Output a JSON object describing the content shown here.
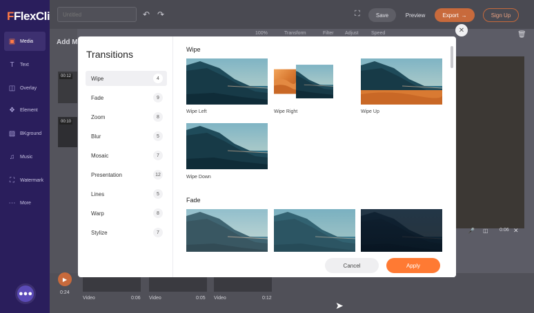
{
  "app": {
    "logo_text": "FlexClip",
    "project_title_placeholder": "Untitled",
    "accent_color": "#ff7a33",
    "sidebar_color": "#2a1e5c"
  },
  "sidebar": {
    "items": [
      {
        "label": "Media",
        "icon": "media-icon"
      },
      {
        "label": "Text",
        "icon": "text-icon"
      },
      {
        "label": "Overlay",
        "icon": "overlay-icon"
      },
      {
        "label": "Element",
        "icon": "element-icon"
      },
      {
        "label": "BKground",
        "icon": "background-icon"
      },
      {
        "label": "Music",
        "icon": "music-icon"
      },
      {
        "label": "Watermark",
        "icon": "watermark-icon"
      },
      {
        "label": "More",
        "icon": "more-icon"
      }
    ]
  },
  "toolbar": {
    "save_label": "Save",
    "preview_label": "Preview",
    "export_label": "Export",
    "signup_label": "Sign Up"
  },
  "background": {
    "media_title": "Add M",
    "thumb_a_time": "00:12",
    "thumb_b_time": "00:10",
    "zoom": "100%",
    "edit_tools": [
      "Transform",
      "Filter",
      "Adjust",
      "Speed"
    ],
    "scene_time": "0:06",
    "play_time": "0:24",
    "clips": [
      {
        "label": "Video",
        "duration": "0:06"
      },
      {
        "label": "Video",
        "duration": "0:05"
      },
      {
        "label": "Video",
        "duration": "0:12"
      }
    ]
  },
  "transitions": {
    "title": "Transitions",
    "categories": [
      {
        "label": "Wipe",
        "count": "4"
      },
      {
        "label": "Fade",
        "count": "9"
      },
      {
        "label": "Zoom",
        "count": "8"
      },
      {
        "label": "Blur",
        "count": "5"
      },
      {
        "label": "Mosaic",
        "count": "7"
      },
      {
        "label": "Presentation",
        "count": "12"
      },
      {
        "label": "Lines",
        "count": "5"
      },
      {
        "label": "Warp",
        "count": "8"
      },
      {
        "label": "Stylize",
        "count": "7"
      }
    ],
    "sections": [
      {
        "heading": "Wipe",
        "items": [
          "Wipe Left",
          "Wipe Right",
          "Wipe Up",
          "Wipe Down"
        ]
      },
      {
        "heading": "Fade"
      }
    ],
    "cancel_label": "Cancel",
    "apply_label": "Apply"
  }
}
